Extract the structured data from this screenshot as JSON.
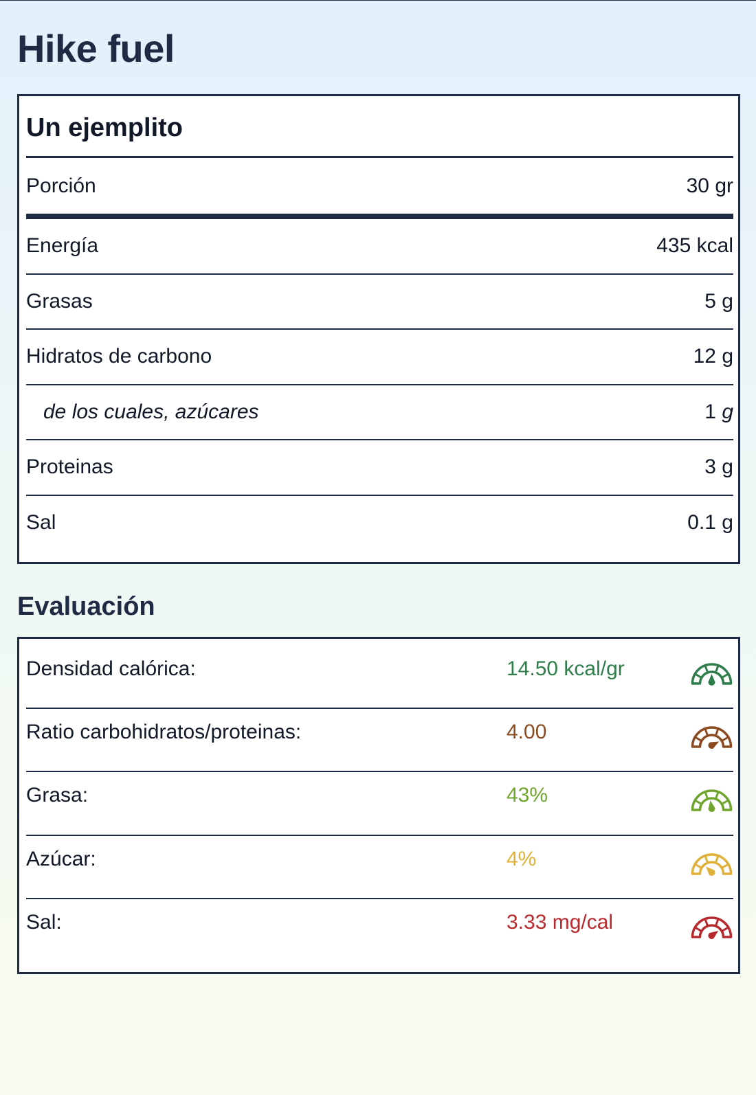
{
  "page": {
    "title": "Hike fuel"
  },
  "nutrition": {
    "title": "Un ejemplito",
    "serving": {
      "label": "Porción",
      "value": "30 gr"
    },
    "rows": [
      {
        "label": "Energía",
        "value": "435 kcal"
      },
      {
        "label": "Grasas",
        "value": "5 g"
      },
      {
        "label": "Hidratos de carbono",
        "value": "12 g"
      },
      {
        "label": "de los cuales, azúcares",
        "value": "1",
        "unit": "g"
      },
      {
        "label": "Proteinas",
        "value": "3 g"
      },
      {
        "label": "Sal",
        "value": "0.1 g"
      }
    ]
  },
  "evaluation": {
    "title": "Evaluación",
    "rows": [
      {
        "label": "Densidad calórica:",
        "value": "14.50 kcal/gr",
        "color": "#2e7d4a",
        "gauge_icon": "gauge-icon",
        "gauge_level": 0.5
      },
      {
        "label": "Ratio carbohidratos/proteinas:",
        "value": "4.00",
        "color": "#8b4a1f",
        "gauge_icon": "gauge-icon",
        "gauge_level": 0.85
      },
      {
        "label": "Grasa:",
        "value": "43%",
        "color": "#6fa52c",
        "gauge_icon": "gauge-icon",
        "gauge_level": 0.45
      },
      {
        "label": "Azúcar:",
        "value": "4%",
        "color": "#e0b13a",
        "gauge_icon": "gauge-icon",
        "gauge_level": 0.25
      },
      {
        "label": "Sal:",
        "value": "3.33 mg/cal",
        "color": "#b8292d",
        "gauge_icon": "gauge-icon",
        "gauge_level": 0.8
      }
    ]
  }
}
